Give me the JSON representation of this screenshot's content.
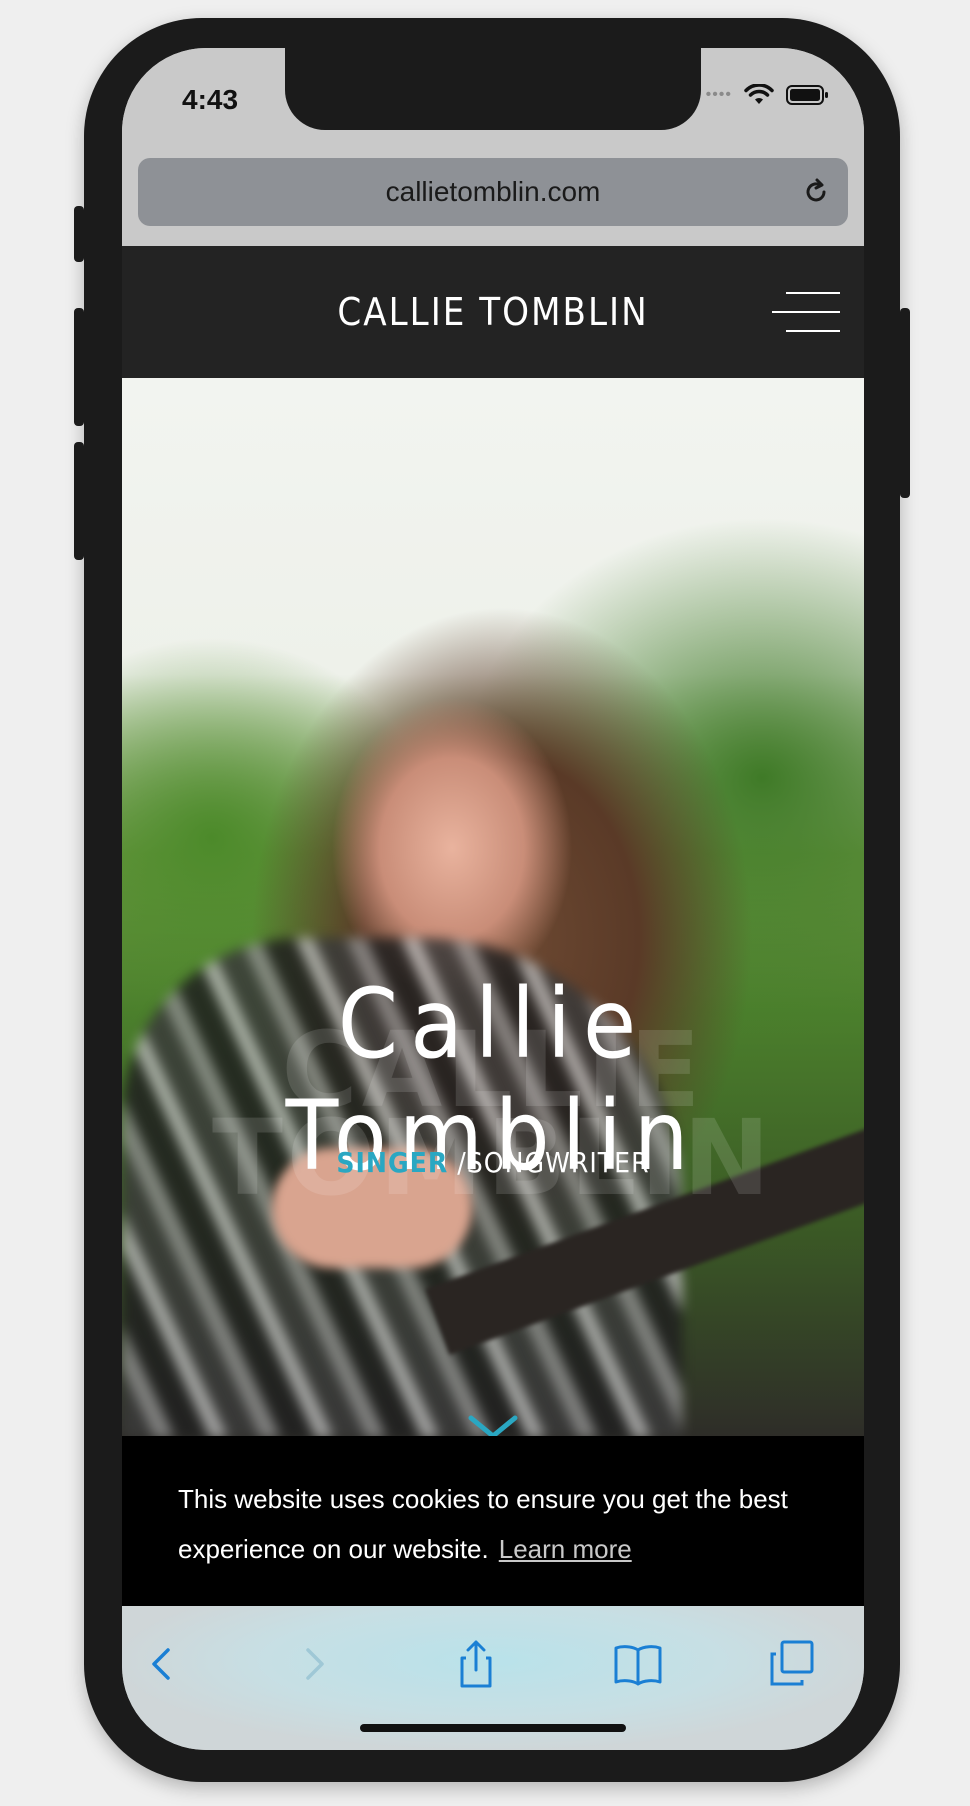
{
  "status_bar": {
    "time": "4:43",
    "signal": "••••"
  },
  "browser": {
    "url": "callietomblin.com"
  },
  "site_header": {
    "brand": "CALLIE TOMBLIN"
  },
  "hero": {
    "title": "Callie Tomblin",
    "ghost_text": "CALLIE TOMBLIN",
    "subtitle_accent": "SINGER",
    "subtitle_separator": " /",
    "subtitle_rest": "SONGWRITER"
  },
  "cookie_banner": {
    "message": "This website uses cookies to ensure you get the best experience on our website.",
    "learn_more": "Learn more"
  },
  "colors": {
    "accent": "#2aa7c2",
    "nav_bg": "#232323",
    "ios_blue": "#1a7fd4"
  }
}
